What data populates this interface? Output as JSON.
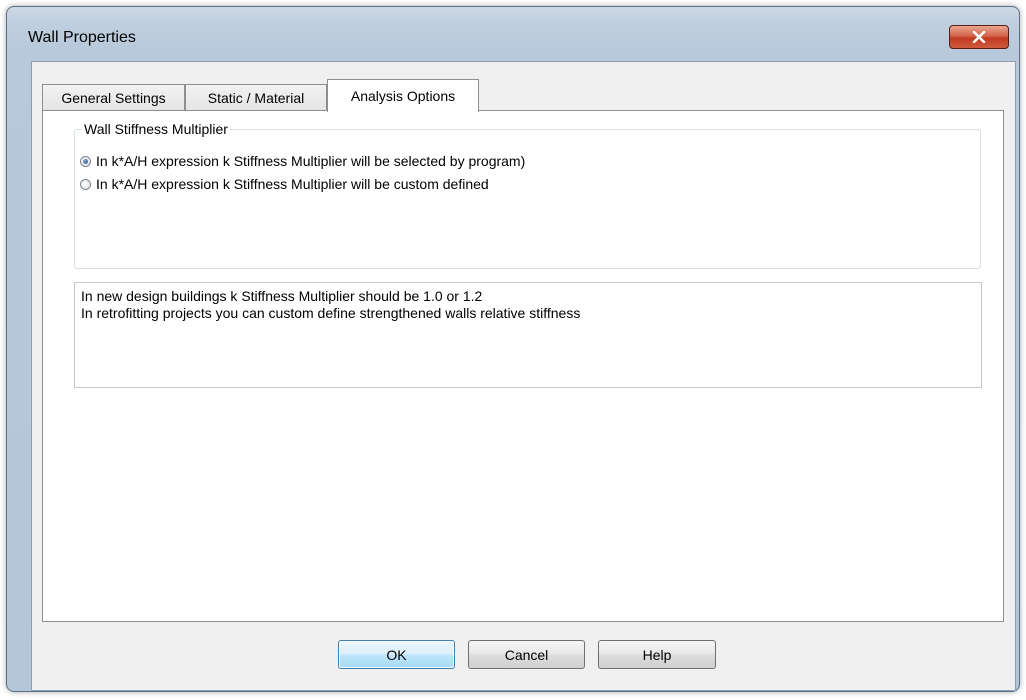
{
  "window": {
    "title": "Wall Properties",
    "close_glyph": "x"
  },
  "tabs": [
    {
      "label": "General Settings",
      "active": false
    },
    {
      "label": "Static / Material",
      "active": false
    },
    {
      "label": "Analysis Options",
      "active": true
    }
  ],
  "stiffness_group": {
    "label": "Wall Stiffness Multiplier",
    "options": [
      {
        "label": "In k*A/H expression k Stiffness Multiplier will be selected by program)",
        "checked": true
      },
      {
        "label": "In k*A/H expression k Stiffness Multiplier will be custom defined",
        "checked": false
      }
    ]
  },
  "info": {
    "lines": [
      "In new design buildings k Stiffness Multiplier should be 1.0 or 1.2",
      "In retrofitting projects you can custom define strengthened walls relative stiffness"
    ]
  },
  "buttons": {
    "ok": "OK",
    "cancel": "Cancel",
    "help": "Help"
  },
  "colors": {
    "title_bar": "#b8c9db",
    "close_button": "#c94a30",
    "default_button_border": "#3c7fb1"
  }
}
